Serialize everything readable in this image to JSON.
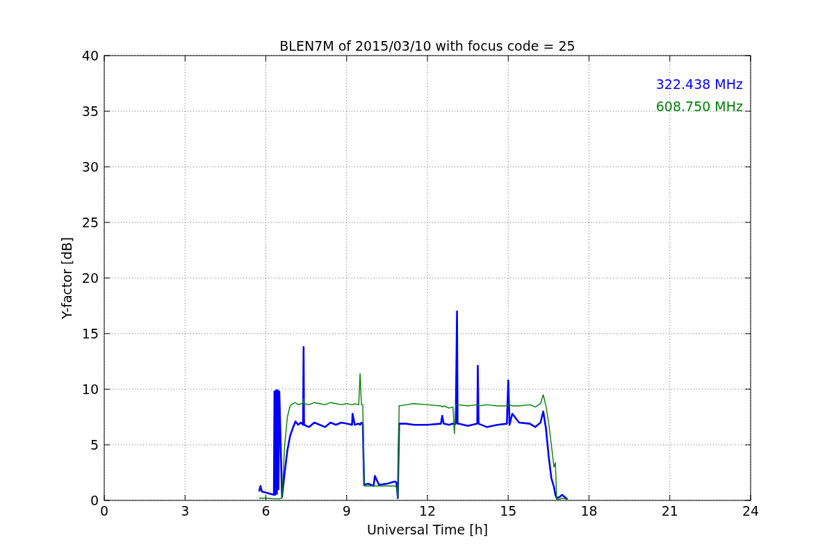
{
  "chart": {
    "chart_data": {
      "type": "line",
      "title": "BLEN7M of 2015/03/10 with focus code = 25",
      "xlabel": "Universal Time [h]",
      "ylabel": "Y-factor [dB]",
      "grid": true,
      "xlim": [
        0,
        24
      ],
      "ylim": [
        0,
        40
      ],
      "xticks": [
        0,
        3,
        6,
        9,
        12,
        15,
        18,
        21,
        24
      ],
      "yticks": [
        0,
        5,
        10,
        15,
        20,
        25,
        30,
        35,
        40
      ],
      "x": [
        5.75,
        5.8,
        5.85,
        6.0,
        6.3,
        6.32,
        6.35,
        6.38,
        6.41,
        6.44,
        6.47,
        6.5,
        6.6,
        6.7,
        6.8,
        6.9,
        7.0,
        7.1,
        7.2,
        7.3,
        7.38,
        7.4,
        7.42,
        7.6,
        7.8,
        8.0,
        8.2,
        8.4,
        8.6,
        8.8,
        9.0,
        9.2,
        9.22,
        9.3,
        9.45,
        9.5,
        9.55,
        9.6,
        9.65,
        9.8,
        10.0,
        10.05,
        10.2,
        10.5,
        10.8,
        10.85,
        10.9,
        10.95,
        11.2,
        11.5,
        12.0,
        12.5,
        12.55,
        12.6,
        12.8,
        12.95,
        13.0,
        13.05,
        13.1,
        13.12,
        13.15,
        13.5,
        13.85,
        13.87,
        13.9,
        14.2,
        14.6,
        14.95,
        15.0,
        15.05,
        15.15,
        15.4,
        15.8,
        16.0,
        16.2,
        16.3,
        16.4,
        16.5,
        16.6,
        16.7,
        16.75,
        16.8,
        16.9,
        17.0,
        17.2
      ],
      "series": [
        {
          "name": "322.438 MHz",
          "color": "#0000ff",
          "values": [
            0.8,
            1.3,
            0.8,
            0.7,
            0.5,
            9.8,
            0.5,
            9.9,
            0.6,
            9.9,
            1.0,
            9.8,
            0.3,
            2.5,
            4.5,
            5.8,
            6.5,
            7.1,
            6.8,
            7.0,
            6.8,
            13.8,
            6.8,
            6.6,
            7.0,
            6.8,
            6.6,
            7.0,
            6.8,
            7.0,
            6.9,
            6.8,
            7.8,
            6.8,
            6.9,
            6.8,
            7.0,
            6.9,
            1.4,
            1.5,
            1.3,
            2.2,
            1.4,
            1.5,
            1.7,
            1.6,
            0.2,
            6.9,
            6.9,
            6.8,
            6.8,
            6.9,
            7.6,
            6.9,
            6.8,
            6.9,
            6.8,
            6.9,
            17.0,
            6.9,
            6.9,
            6.7,
            6.9,
            12.1,
            6.9,
            6.6,
            6.8,
            6.9,
            10.8,
            6.8,
            7.8,
            7.0,
            6.9,
            6.6,
            7.0,
            8.0,
            6.5,
            4.0,
            2.0,
            1.2,
            0.5,
            0.2,
            0.3,
            0.5,
            0.1
          ]
        },
        {
          "name": "608.750 MHz",
          "color": "#008000",
          "values": [
            0.2,
            0.2,
            0.2,
            0.2,
            0.15,
            0.15,
            0.15,
            0.15,
            0.15,
            0.15,
            0.15,
            0.15,
            0.2,
            5.0,
            7.5,
            8.5,
            8.7,
            8.8,
            8.6,
            8.7,
            8.7,
            9.2,
            8.7,
            8.6,
            8.8,
            8.7,
            8.6,
            8.8,
            8.7,
            8.6,
            8.7,
            8.6,
            8.6,
            8.7,
            8.6,
            11.4,
            8.6,
            8.6,
            1.3,
            1.3,
            1.3,
            1.3,
            1.3,
            1.3,
            1.3,
            1.2,
            0.2,
            8.5,
            8.6,
            8.7,
            8.6,
            8.5,
            8.4,
            8.5,
            8.3,
            8.4,
            6.0,
            8.6,
            8.6,
            8.6,
            8.6,
            8.5,
            8.6,
            8.6,
            8.5,
            8.6,
            8.5,
            8.5,
            8.6,
            8.6,
            8.5,
            8.5,
            8.6,
            8.4,
            8.7,
            9.5,
            8.5,
            7.0,
            5.0,
            3.0,
            3.4,
            0.1,
            0.1,
            0.2,
            0.1
          ]
        }
      ]
    }
  }
}
